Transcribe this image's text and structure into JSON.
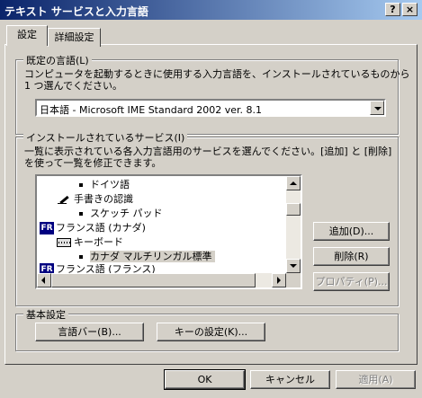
{
  "window": {
    "title": "テキスト サービスと入力言語",
    "help_label": "?",
    "close_label": "×"
  },
  "tabs": [
    {
      "label": "設定"
    },
    {
      "label": "詳細設定"
    }
  ],
  "default_language": {
    "group_title": "既定の言語(L)",
    "description_line1": "コンピュータを起動するときに使用する入力言語を、インストールされているものから",
    "description_line2": "1 つ選んでください。",
    "selected_value": "日本語 - Microsoft IME Standard 2002 ver. 8.1"
  },
  "installed_services": {
    "group_title": "インストールされているサービス(I)",
    "description_line1": "一覧に表示されている各入力言語用のサービスを選んでください。[追加] と [削除]",
    "description_line2": "を使って一覧を修正できます。",
    "tree_items": [
      {
        "label": "ドイツ語",
        "icon": "bullet"
      },
      {
        "label": "手書きの認識",
        "icon": "pen-icon"
      },
      {
        "label": "スケッチ パッド",
        "icon": "bullet"
      },
      {
        "label": "フランス語 (カナダ)",
        "icon": "fr-flag-icon",
        "badge": "FR"
      },
      {
        "label": "キーボード",
        "icon": "keyboard-icon"
      },
      {
        "label": "カナダ マルチリンガル標準",
        "icon": "bullet",
        "selected": true
      },
      {
        "label": "フランス語 (フランス)",
        "icon": "fr-flag-icon",
        "badge": "FR"
      }
    ],
    "buttons": {
      "add": "追加(D)...",
      "remove": "削除(R)",
      "properties": "プロパティ(P)..."
    }
  },
  "basic_settings": {
    "group_title": "基本設定",
    "language_bar": "言語バー(B)...",
    "key_settings": "キーの設定(K)..."
  },
  "footer": {
    "ok": "OK",
    "cancel": "キャンセル",
    "apply": "適用(A)"
  }
}
